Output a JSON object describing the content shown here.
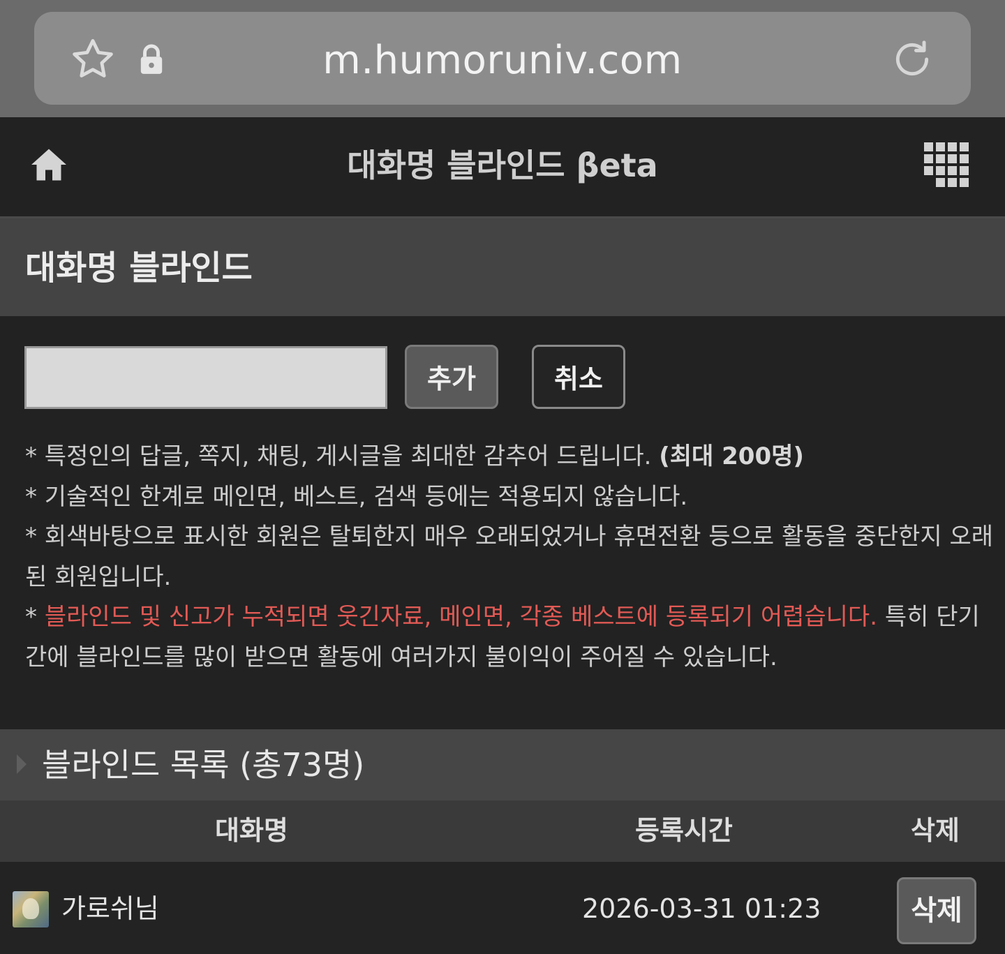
{
  "browser": {
    "url": "m.humoruniv.com",
    "icons": {
      "bookmark": "star-icon",
      "secure": "lock-icon",
      "reload": "reload-icon"
    }
  },
  "header": {
    "title": "대화명 블라인드 βeta",
    "icons": {
      "home": "home-icon",
      "menu": "grid-menu-icon"
    }
  },
  "section": {
    "title": "대화명 블라인드"
  },
  "form": {
    "input_value": "",
    "input_placeholder": "",
    "add_label": "추가",
    "cancel_label": "취소"
  },
  "notes": {
    "line1_text": "* 특정인의 답글, 쪽지, 채팅, 게시글을 최대한 감추어 드립니다. ",
    "line1_bold": "(최대 200명)",
    "line2": "* 기술적인 한계로 메인면, 베스트, 검색 등에는 적용되지 않습니다.",
    "line3": "* 회색바탕으로 표시한 회원은 탈퇴한지 매우 오래되었거나 휴면전환 등으로 활동을 중단한지 오래된 회원입니다.",
    "line4_prefix": "* ",
    "line4_red": "블라인드 및 신고가 누적되면 웃긴자료, 메인면, 각종 베스트에 등록되기 어렵습니다.",
    "line4_rest": " 특히 단기간에 블라인드를 많이 받으면 활동에 여러가지 불이익이 주어질 수 있습니다."
  },
  "list": {
    "title": "블라인드 목록 (총73명)",
    "columns": {
      "name": "대화명",
      "time": "등록시간",
      "delete": "삭제"
    },
    "rows": [
      {
        "name": "가로쉬님",
        "time": "2026-03-31 01:23",
        "delete_label": "삭제"
      }
    ]
  },
  "colors": {
    "background": "#222222",
    "warning_red": "#e25a55",
    "button_gray": "#5a5a5a"
  }
}
